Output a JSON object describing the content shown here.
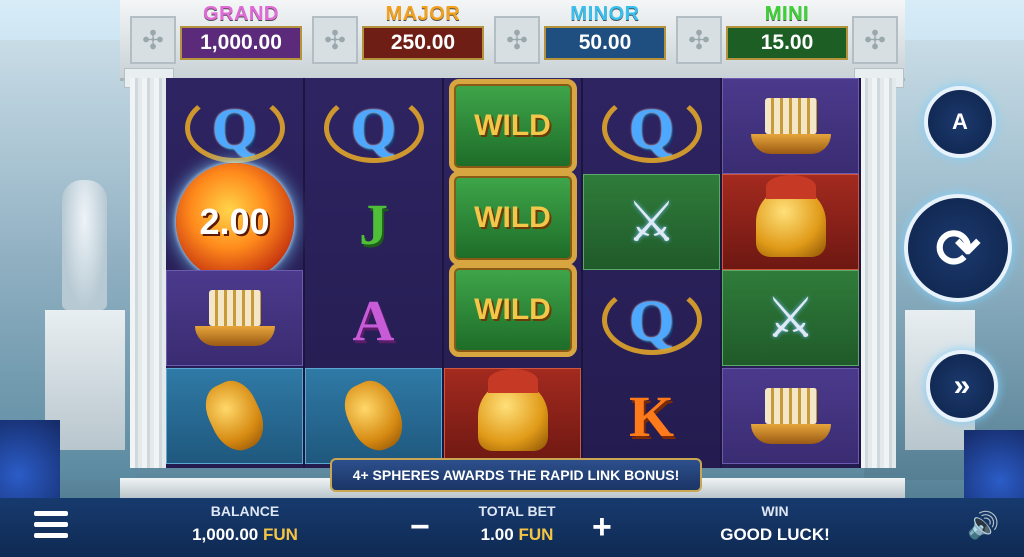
{
  "jackpots": [
    {
      "name": "GRAND",
      "value": "1,000.00",
      "label_color": "#e06ad8",
      "box_color": "#5b2a7a"
    },
    {
      "name": "MAJOR",
      "value": "250.00",
      "label_color": "#f3a11c",
      "box_color": "#6e1e14"
    },
    {
      "name": "MINOR",
      "value": "50.00",
      "label_color": "#39c0ee",
      "box_color": "#1f4e80"
    },
    {
      "name": "MINI",
      "value": "15.00",
      "label_color": "#3ed236",
      "box_color": "#1c5e24"
    }
  ],
  "reels": {
    "reel1": [
      "Q",
      "2.00",
      "ship",
      "amphora"
    ],
    "reel2": [
      "Q",
      "J",
      "A",
      "amphora"
    ],
    "reel3": [
      "WILD",
      "WILD",
      "WILD",
      "helmet"
    ],
    "reel4": [
      "Q",
      "swords",
      "Q",
      "K"
    ],
    "reel5": [
      "ship",
      "helmet",
      "swords",
      "ship"
    ]
  },
  "sphere_value": "2.00",
  "wild_label": "WILD",
  "letters": {
    "q": "Q",
    "j": "J",
    "a": "A",
    "k": "K"
  },
  "banner": "4+ SPHERES AWARDS THE RAPID LINK BONUS!",
  "balance": {
    "label": "BALANCE",
    "amount": "1,000.00",
    "currency": "FUN"
  },
  "total_bet": {
    "label": "TOTAL BET",
    "amount": "1.00",
    "currency": "FUN"
  },
  "win": {
    "label": "WIN",
    "value": "GOOD LUCK!"
  },
  "controls": {
    "minus": "−",
    "plus": "+",
    "autoplay_icon": "A",
    "spin_icon": "spin-arrows-icon",
    "turbo_icon": "fast-forward-icon",
    "menu_icon": "hamburger-menu-icon",
    "sound_icon": "speaker-icon"
  }
}
